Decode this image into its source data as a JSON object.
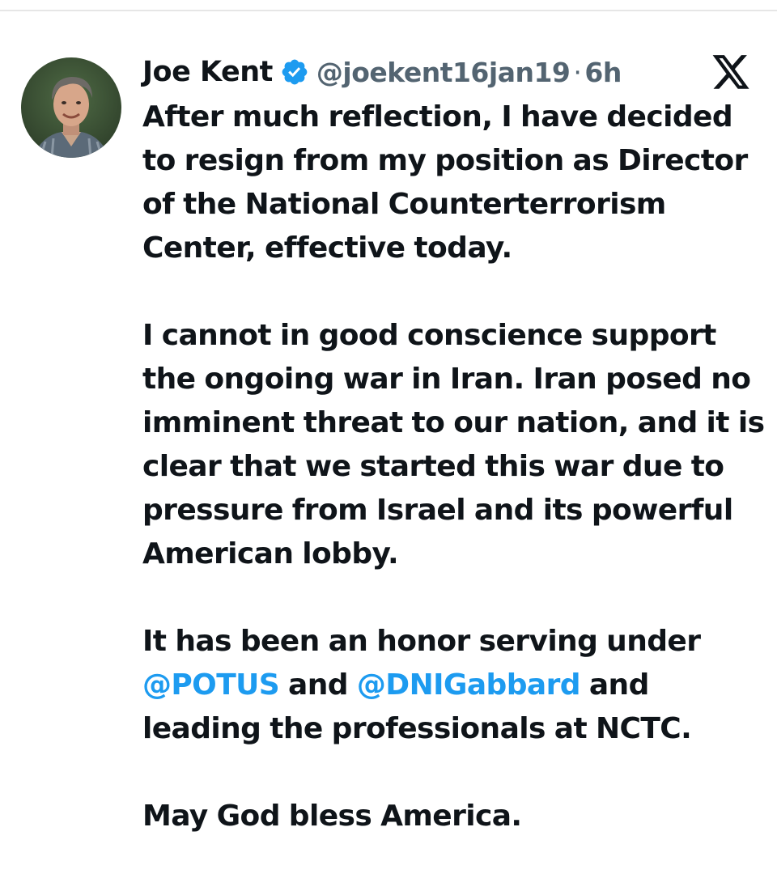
{
  "author": {
    "name": "Joe Kent",
    "handle": "@joekent16jan19",
    "separator": "·",
    "time": "6h",
    "verified_icon": "verified-badge-icon",
    "avatar_icon": "profile-photo"
  },
  "platform": {
    "logo_icon": "x-logo-icon"
  },
  "tweet": {
    "p1": "After much reflection, I have decided to resign from my position as Director of the National Counterterrorism Center, effective today.",
    "p2": "I cannot in good conscience support the ongoing war in Iran. Iran posed no imminent threat to our nation, and it is clear that we started this war due to pressure from Israel and its powerful American lobby.",
    "p3": {
      "t1": "It has been an honor serving under",
      "mention1": "@POTUS",
      "t2": "and",
      "mention2": "@DNIGabbard",
      "t3": "and leading the professionals at NCTC."
    },
    "p4": "May God bless America."
  },
  "colors": {
    "text": "#0f1419",
    "secondary": "#536471",
    "link": "#1d9bf0",
    "verified": "#1d9bf0"
  }
}
